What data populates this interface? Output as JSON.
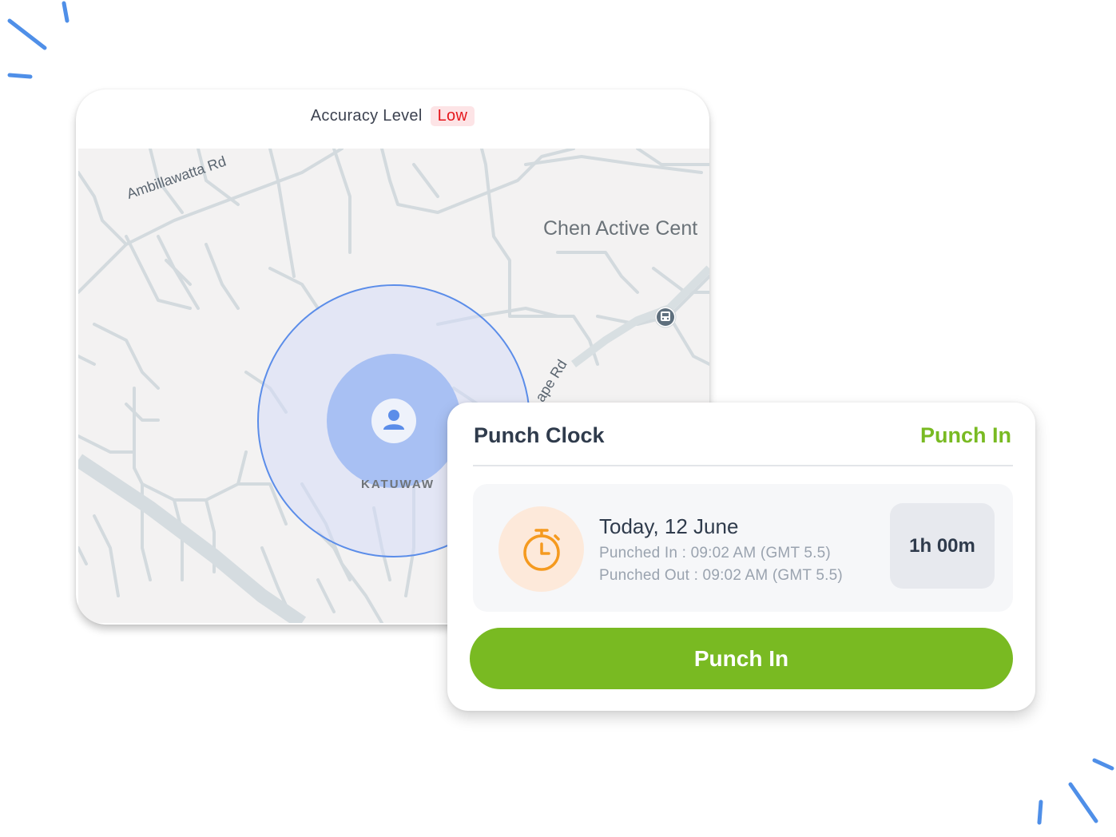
{
  "accuracy": {
    "label": "Accuracy Level",
    "value": "Low",
    "value_color": "#e5161b",
    "badge_bg": "#fde4e6"
  },
  "map": {
    "road_labels": [
      "Ambillawatta Rd",
      "Chen Active Cent",
      "ape Rd"
    ],
    "area_label": "KATUWAW",
    "user_marker_icon": "user-location-icon",
    "transit_icon": "bus-stop-icon"
  },
  "punch_clock": {
    "title": "Punch Clock",
    "status": "Punch In",
    "date": "Today, 12 June",
    "punched_in": "Punched In : 09:02 AM (GMT 5.5)",
    "punched_out": "Punched Out : 09:02 AM (GMT 5.5)",
    "duration": "1h 00m",
    "button_label": "Punch In",
    "timer_icon": "stopwatch-icon",
    "accent_color": "#79ba22",
    "timer_color": "#f59a1f"
  }
}
